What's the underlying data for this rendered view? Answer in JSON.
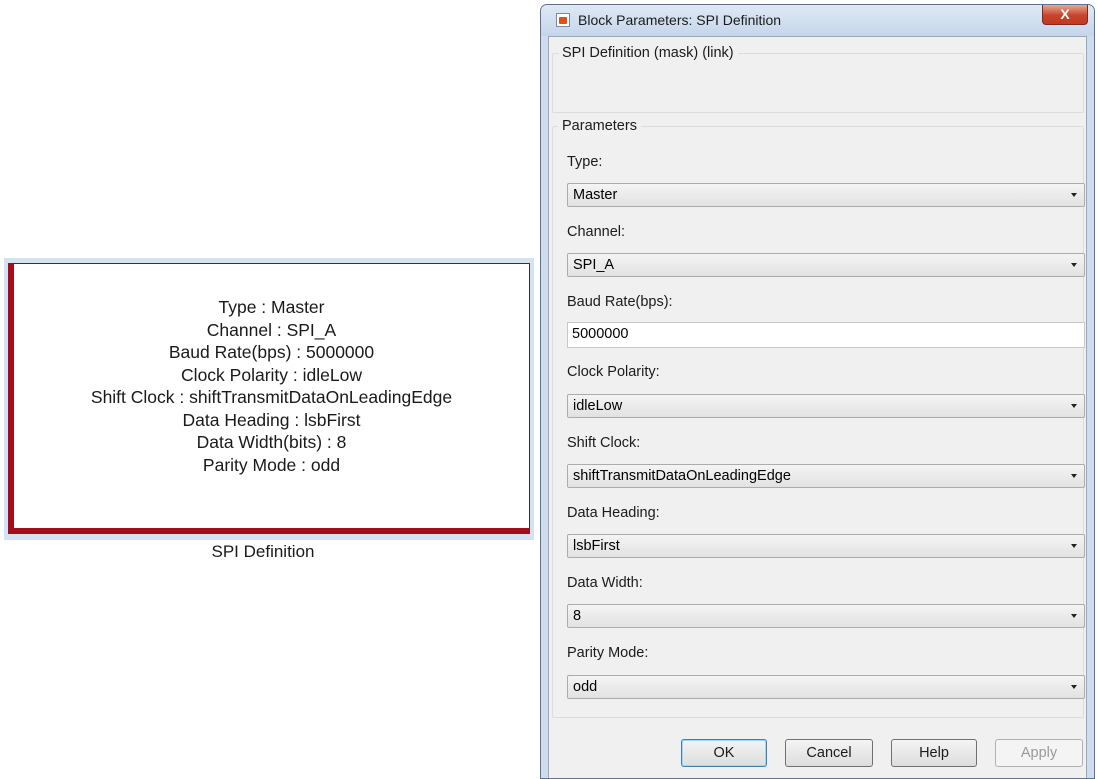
{
  "block": {
    "lines": [
      "Type : Master",
      "Channel : SPI_A",
      "Baud Rate(bps) : 5000000",
      "Clock Polarity : idleLow",
      "Shift Clock : shiftTransmitDataOnLeadingEdge",
      "Data Heading : lsbFirst",
      "Data Width(bits) : 8",
      "Parity Mode : odd"
    ],
    "caption": "SPI Definition",
    "border_color": "#a30d1c",
    "selection_color": "#d4e2f4"
  },
  "dialog": {
    "title": "Block Parameters: SPI Definition",
    "close_label": "X",
    "mask_title": "SPI Definition (mask) (link)",
    "params_legend": "Parameters",
    "fields": {
      "type": {
        "label": "Type:",
        "value": "Master"
      },
      "channel": {
        "label": "Channel:",
        "value": "SPI_A"
      },
      "baud_rate": {
        "label": "Baud Rate(bps):",
        "value": "5000000"
      },
      "clock_polarity": {
        "label": "Clock Polarity:",
        "value": "idleLow"
      },
      "shift_clock": {
        "label": "Shift Clock:",
        "value": "shiftTransmitDataOnLeadingEdge"
      },
      "data_heading": {
        "label": "Data Heading:",
        "value": "lsbFirst"
      },
      "data_width": {
        "label": "Data Width:",
        "value": "8"
      },
      "parity_mode": {
        "label": "Parity Mode:",
        "value": "odd"
      }
    },
    "buttons": {
      "ok": "OK",
      "cancel": "Cancel",
      "help": "Help",
      "apply": "Apply"
    }
  },
  "icons": {
    "title_icon": "simulink-block-icon",
    "close": "close-icon",
    "dropdown": "chevron-down-icon"
  }
}
